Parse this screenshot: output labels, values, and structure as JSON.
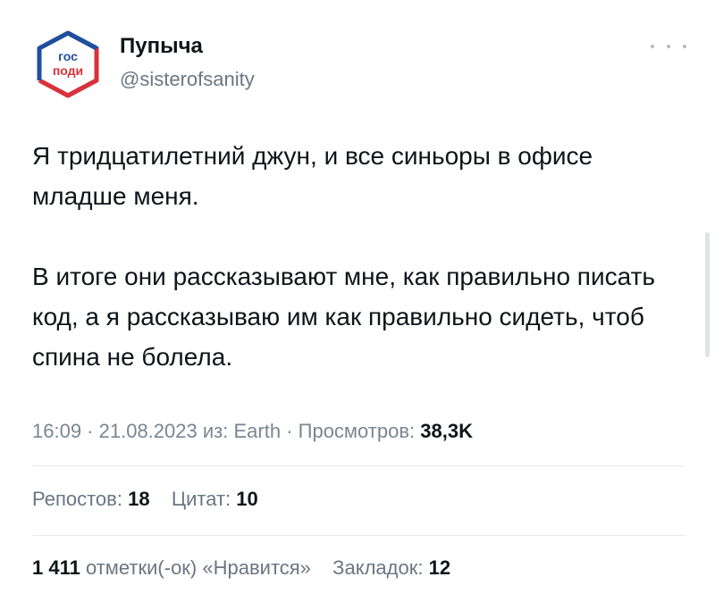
{
  "author": {
    "avatar_text_top": "гос",
    "avatar_text_bottom": "поди",
    "name": "Пупыча",
    "handle": "@sisterofsanity"
  },
  "tweet": {
    "paragraph_1": "Я тридцатилетний джун, и все синьоры в офисе младше меня.",
    "paragraph_2": "В итоге они рассказывают мне, как правильно писать код, а я рассказываю им как правильно сидеть, чтоб спина не болела."
  },
  "meta": {
    "time": "16:09",
    "separator": " · ",
    "date": "21.08.2023",
    "source_label": "из:",
    "source": "Earth",
    "views_label": "Просмотров:",
    "views": "38,3K"
  },
  "stats": {
    "reposts_label": "Репостов:",
    "reposts": "18",
    "quotes_label": "Цитат:",
    "quotes": "10",
    "likes": "1 411",
    "likes_label": "отметки(-ок) «Нравится»",
    "bookmarks_label": "Закладок:",
    "bookmarks": "12"
  },
  "colors": {
    "avatar_blue": "#1f4e9c",
    "avatar_red": "#d9323a",
    "secondary_text": "#6b7682",
    "divider": "#e6e9ec"
  },
  "icons": {
    "more": "more-horizontal-icon"
  }
}
